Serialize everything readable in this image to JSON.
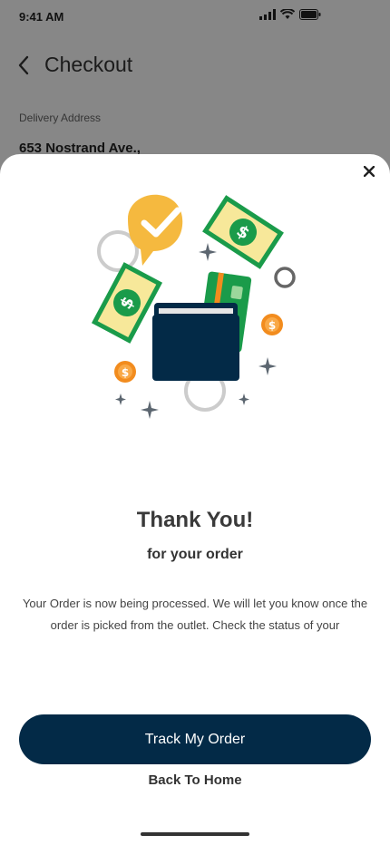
{
  "status_bar": {
    "time": "9:41 AM"
  },
  "header": {
    "title": "Checkout"
  },
  "delivery": {
    "label": "Delivery Address",
    "value": "653 Nostrand Ave.,"
  },
  "modal": {
    "title": "Thank You!",
    "subtitle": "for your order",
    "message": "Your Order is now being processed. We will let you know once the order is picked from the outlet. Check the status of your",
    "primary_button": "Track My Order",
    "secondary_button": "Back To Home"
  },
  "colors": {
    "primary": "#032a47",
    "money_green": "#1a9b4a",
    "money_light": "#f7e89a",
    "coin_orange": "#f28c1e",
    "badge_yellow": "#f5b93f"
  }
}
